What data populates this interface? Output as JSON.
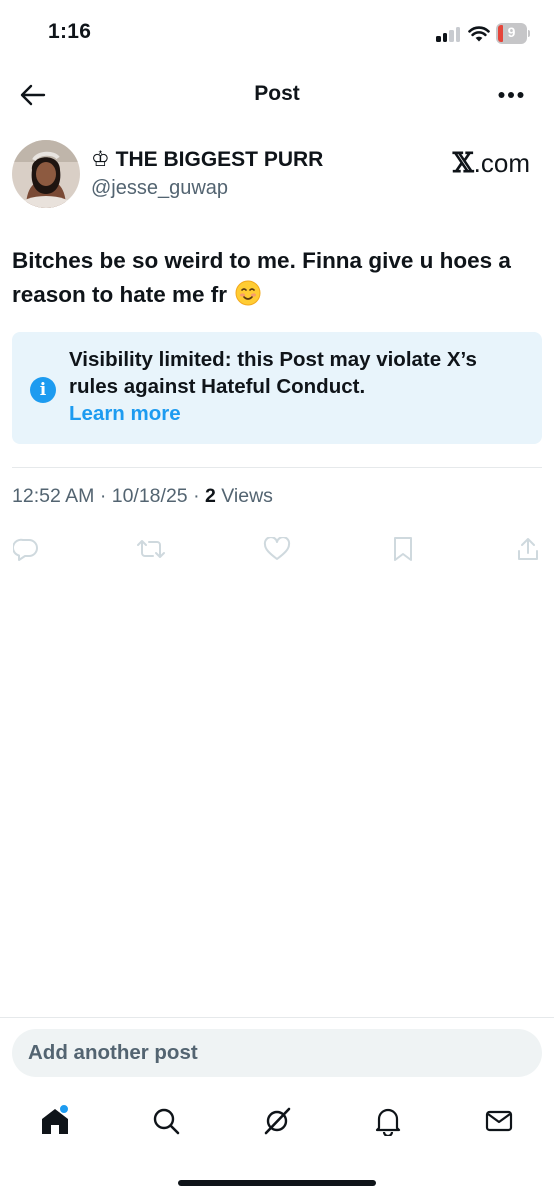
{
  "status_bar": {
    "time": "1:16",
    "battery_level": "9",
    "battery_color": "#e5453a"
  },
  "header": {
    "back_icon": "arrow-left-icon",
    "title": "Post",
    "more_icon": "more-horizontal-icon"
  },
  "post": {
    "author": {
      "display_name": "♔ THE BIGGEST PURR",
      "handle": "@jesse_guwap",
      "source_label": "X.com",
      "source_symbol": "𝕏",
      "source_suffix": ".com"
    },
    "text": "Bitches be so weird to me. Finna give u hoes a reason to hate me fr",
    "emoji": "smiling-face-emoji",
    "notice": {
      "icon": "info-icon",
      "message": "Visibility limited: this Post may violate X’s rules against Hateful Conduct.",
      "link_label": "Learn more",
      "background": "#e8f4fb",
      "link_color": "#1d9bf0"
    },
    "meta": {
      "time": "12:52 AM",
      "date": "10/18/25",
      "views_count": "2",
      "views_label": "Views"
    },
    "actions": [
      {
        "name": "reply",
        "icon": "reply-icon"
      },
      {
        "name": "repost",
        "icon": "repost-icon"
      },
      {
        "name": "like",
        "icon": "heart-icon"
      },
      {
        "name": "bookmark",
        "icon": "bookmark-icon"
      },
      {
        "name": "share",
        "icon": "share-icon"
      }
    ]
  },
  "composer": {
    "placeholder": "Add another post"
  },
  "tabbar": {
    "items": [
      {
        "name": "home",
        "icon": "home-icon",
        "active": true,
        "has_badge": true
      },
      {
        "name": "search",
        "icon": "search-icon"
      },
      {
        "name": "grok",
        "icon": "grok-icon"
      },
      {
        "name": "notifications",
        "icon": "bell-icon"
      },
      {
        "name": "messages",
        "icon": "mail-icon"
      }
    ]
  },
  "colors": {
    "accent": "#1d9bf0",
    "text_primary": "#0f1419",
    "text_secondary": "#536471",
    "action_icons": "#cfd9de"
  }
}
